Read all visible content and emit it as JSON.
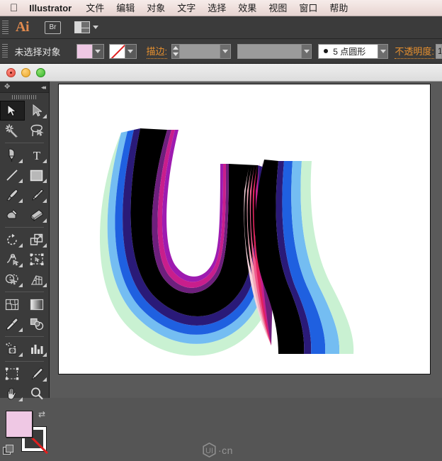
{
  "menubar": {
    "apple_icon": "apple-logo",
    "app_name": "Illustrator",
    "items": [
      {
        "label": "文件"
      },
      {
        "label": "编辑"
      },
      {
        "label": "对象"
      },
      {
        "label": "文字"
      },
      {
        "label": "选择"
      },
      {
        "label": "效果"
      },
      {
        "label": "视图"
      },
      {
        "label": "窗口"
      },
      {
        "label": "帮助"
      }
    ]
  },
  "appbar": {
    "logo": "Ai",
    "bridge_label": "Br",
    "arrange_icon": "arrange-documents-icon"
  },
  "controlbar": {
    "selection_status": "未选择对象",
    "fill_swatch_color": "#efc8e4",
    "stroke_swatch": "none",
    "stroke_label": "描边:",
    "stroke_weight_value": "",
    "stroke_style_value": "",
    "brush_definition": "5 点圆形",
    "opacity_label": "不透明度:",
    "opacity_value": "1"
  },
  "titlebar": {
    "close": "close-button",
    "minimize": "minimize-button",
    "zoom": "zoom-button"
  },
  "tools": {
    "panel_drag": "drag-handle",
    "panel_collapse": "collapse-panel",
    "items": [
      {
        "name": "selection-tool",
        "active": true,
        "has_flyout": false
      },
      {
        "name": "direct-selection-tool",
        "active": false,
        "has_flyout": true
      },
      {
        "name": "magic-wand-tool",
        "active": false,
        "has_flyout": false
      },
      {
        "name": "lasso-tool",
        "active": false,
        "has_flyout": false
      },
      {
        "name": "pen-tool",
        "active": false,
        "has_flyout": true
      },
      {
        "name": "type-tool",
        "active": false,
        "has_flyout": true
      },
      {
        "name": "line-segment-tool",
        "active": false,
        "has_flyout": true
      },
      {
        "name": "rectangle-tool",
        "active": false,
        "has_flyout": true
      },
      {
        "name": "paintbrush-tool",
        "active": false,
        "has_flyout": true
      },
      {
        "name": "pencil-tool",
        "active": false,
        "has_flyout": true
      },
      {
        "name": "blob-brush-tool",
        "active": false,
        "has_flyout": false
      },
      {
        "name": "eraser-tool",
        "active": false,
        "has_flyout": true
      },
      {
        "name": "rotate-tool",
        "active": false,
        "has_flyout": true
      },
      {
        "name": "scale-tool",
        "active": false,
        "has_flyout": true
      },
      {
        "name": "width-tool",
        "active": false,
        "has_flyout": true
      },
      {
        "name": "free-transform-tool",
        "active": false,
        "has_flyout": false
      },
      {
        "name": "shape-builder-tool",
        "active": false,
        "has_flyout": true
      },
      {
        "name": "perspective-grid-tool",
        "active": false,
        "has_flyout": true
      },
      {
        "name": "mesh-tool",
        "active": false,
        "has_flyout": false
      },
      {
        "name": "gradient-tool",
        "active": false,
        "has_flyout": false
      },
      {
        "name": "eyedropper-tool",
        "active": false,
        "has_flyout": true
      },
      {
        "name": "blend-tool",
        "active": false,
        "has_flyout": false
      },
      {
        "name": "symbol-sprayer-tool",
        "active": false,
        "has_flyout": true
      },
      {
        "name": "column-graph-tool",
        "active": false,
        "has_flyout": true
      },
      {
        "name": "artboard-tool",
        "active": false,
        "has_flyout": false
      },
      {
        "name": "slice-tool",
        "active": false,
        "has_flyout": true
      },
      {
        "name": "hand-tool",
        "active": false,
        "has_flyout": true
      },
      {
        "name": "zoom-tool",
        "active": false,
        "has_flyout": false
      }
    ],
    "fill_color": "#efc8e4",
    "stroke_color": "none",
    "swap_icon": "swap-fill-stroke-icon"
  },
  "artwork": {
    "description": "blend-lettering-U-I",
    "band_colors": [
      "#c9f1d2",
      "#74bdf2",
      "#1f60e0",
      "#2a1a78",
      "#000000",
      "#6e1f7d",
      "#c81e8c",
      "#f05a8e",
      "#f2a8b8",
      "#f7d4dc"
    ]
  },
  "watermark": {
    "mark": "UI",
    "text": "·cn"
  }
}
